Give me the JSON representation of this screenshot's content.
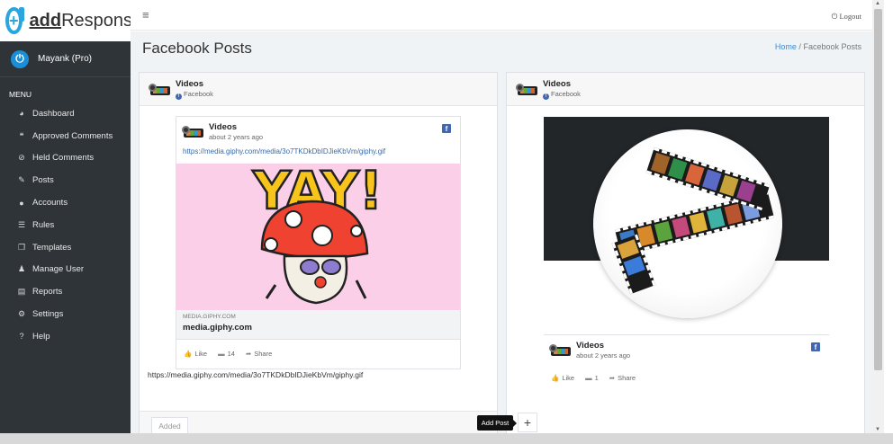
{
  "app": {
    "brand_prefix": "add",
    "brand_suffix": "Response",
    "logo_glyph": "+",
    "accent": "#28a6df"
  },
  "user": {
    "name": "Mayank (Pro)"
  },
  "menu": {
    "header": "MENU",
    "items": [
      {
        "label": "Dashboard",
        "icon": "palette-icon",
        "glyph": "◕"
      },
      {
        "label": "Approved Comments",
        "icon": "comments-icon",
        "glyph": "❝"
      },
      {
        "label": "Held Comments",
        "icon": "eye-slash-icon",
        "glyph": "⊘"
      },
      {
        "label": "Posts",
        "icon": "edit-icon",
        "glyph": "✎"
      },
      {
        "label": "Accounts",
        "icon": "user-circle-icon",
        "glyph": "●"
      },
      {
        "label": "Rules",
        "icon": "list-icon",
        "glyph": "☰"
      },
      {
        "label": "Templates",
        "icon": "copy-icon",
        "glyph": "❐"
      },
      {
        "label": "Manage User",
        "icon": "user-plus-icon",
        "glyph": "♟"
      },
      {
        "label": "Reports",
        "icon": "archive-icon",
        "glyph": "▤"
      },
      {
        "label": "Settings",
        "icon": "cogs-icon",
        "glyph": "⚙"
      },
      {
        "label": "Help",
        "icon": "question-circle-icon",
        "glyph": "?"
      }
    ]
  },
  "topbar": {
    "menu_glyph": "≡",
    "logout": "Logout",
    "logout_glyph": "⏻"
  },
  "page": {
    "title": "Facebook Posts",
    "breadcrumb_home": "Home",
    "breadcrumb_sep": "/",
    "breadcrumb_current": "Facebook Posts"
  },
  "cards": [
    {
      "page_name": "Videos",
      "source": "Facebook",
      "post": {
        "author": "Videos",
        "time": "about 2 years ago",
        "link": "https://media.giphy.com/media/3o7TKDkDbIDJieKbVm/giphy.gif",
        "gif_text": "YAY!",
        "link_domain": "MEDIA.GIPHY.COM",
        "link_title": "media.giphy.com",
        "like_label": "Like",
        "comment_count": "14",
        "share_label": "Share"
      },
      "raw_url": "https://media.giphy.com/media/3o7TKDkDbIDJieKbVm/giphy.gif",
      "footer_status": "Added"
    },
    {
      "page_name": "Videos",
      "source": "Facebook",
      "post": {
        "author": "Videos",
        "time": "about 2 years ago",
        "like_label": "Like",
        "comment_count": "1",
        "share_label": "Share"
      }
    }
  ],
  "actions": {
    "add_post_tooltip": "Add Post",
    "add_glyph": "+"
  },
  "fb_glyph": "f"
}
